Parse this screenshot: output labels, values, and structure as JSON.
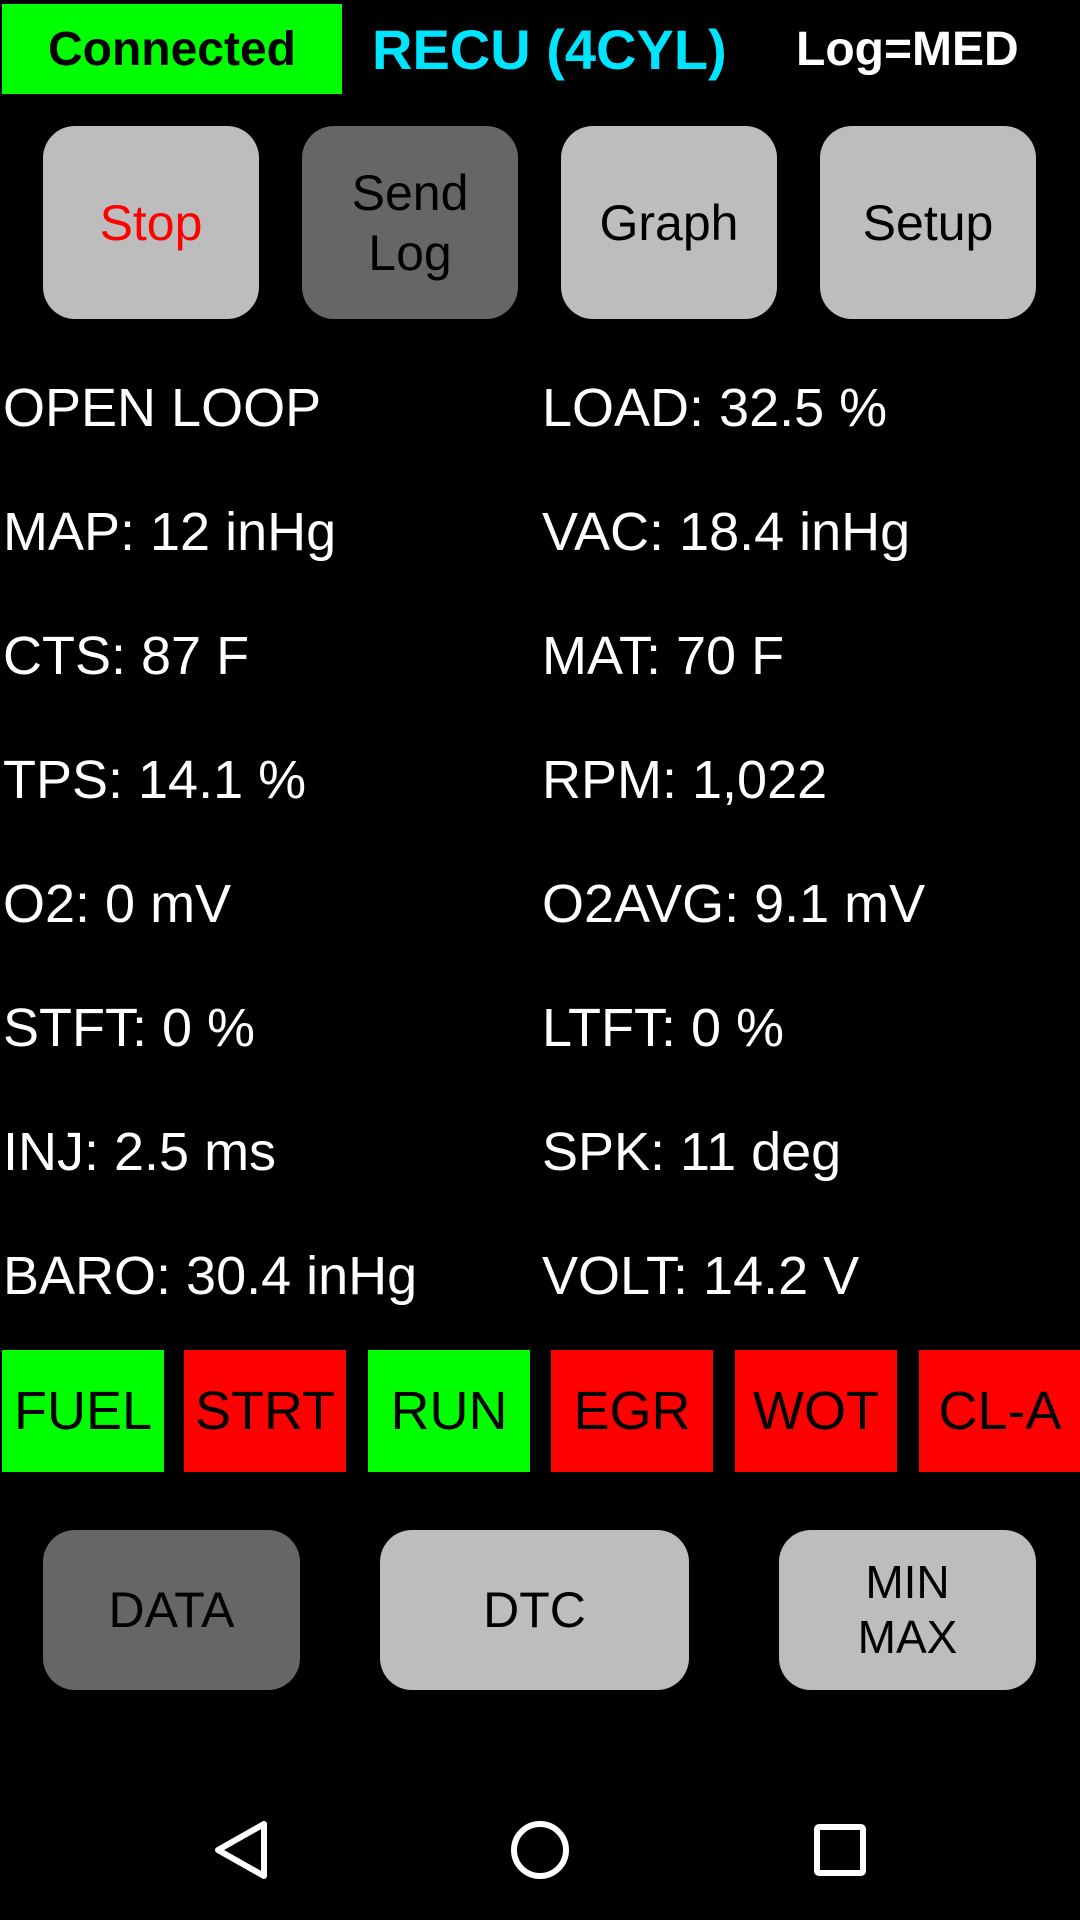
{
  "header": {
    "status": "Connected",
    "ecu": "RECU (4CYL)",
    "log_level": "Log=MED",
    "status_color": "#00ff00",
    "ecu_color": "#00e5ff"
  },
  "toolbar": {
    "stop_label": "Stop",
    "sendlog_label": "Send\nLog",
    "graph_label": "Graph",
    "setup_label": "Setup"
  },
  "readings": {
    "mode": "OPEN LOOP",
    "load": "LOAD: 32.5 %",
    "map": "MAP: 12 inHg",
    "vac": "VAC: 18.4 inHg",
    "cts": "CTS: 87 F",
    "mat": "MAT: 70 F",
    "tps": "TPS: 14.1 %",
    "rpm": "RPM: 1,022",
    "o2": "O2: 0 mV",
    "o2avg": "O2AVG: 9.1 mV",
    "stft": "STFT: 0 %",
    "ltft": "LTFT: 0 %",
    "inj": "INJ: 2.5 ms",
    "spk": "SPK: 11 deg",
    "baro": "BARO: 30.4 inHg",
    "volt": "VOLT: 14.2 V"
  },
  "indicators": [
    {
      "label": "FUEL",
      "state": "on",
      "color": "#00ff00"
    },
    {
      "label": "STRT",
      "state": "off",
      "color": "#ff0000"
    },
    {
      "label": "RUN",
      "state": "on",
      "color": "#00ff00"
    },
    {
      "label": "EGR",
      "state": "off",
      "color": "#ff0000"
    },
    {
      "label": "WOT",
      "state": "off",
      "color": "#ff0000"
    },
    {
      "label": "CL-A",
      "state": "off",
      "color": "#ff0000"
    }
  ],
  "bottom_tabs": {
    "data_label": "DATA",
    "dtc_label": "DTC",
    "minmax_label": "MIN\nMAX"
  },
  "navbar": {
    "back_icon": "back-triangle-icon",
    "home_icon": "home-circle-icon",
    "recents_icon": "recents-square-icon"
  }
}
